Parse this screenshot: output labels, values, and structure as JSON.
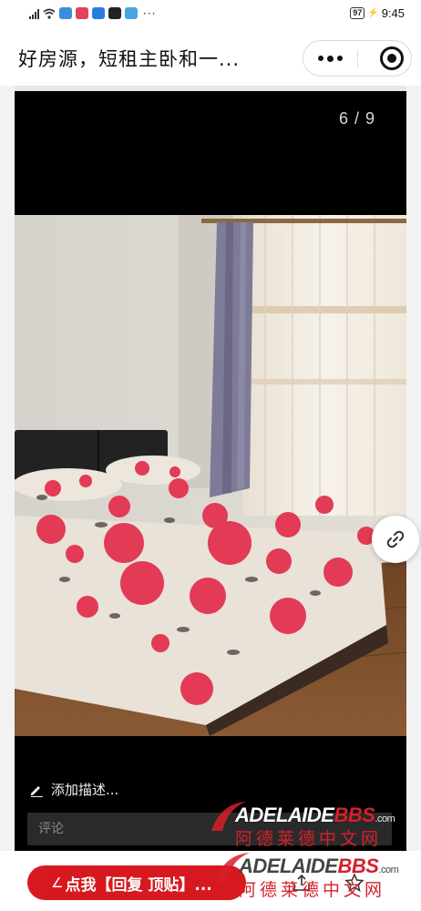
{
  "status_bar": {
    "battery": "97",
    "time": "9:45",
    "more": "···"
  },
  "header": {
    "title": "好房源，短租主卧和一..."
  },
  "viewer": {
    "counter": "6 / 9",
    "add_description": "添加描述...",
    "comment_placeholder": "评论"
  },
  "bottom_bar": {
    "reply_label": "点我【回复 顶贴】..."
  },
  "watermark": {
    "brand": "ADELAIDE",
    "brand_accent": "BBS",
    "domain": ".com",
    "site_name": "阿德莱德中文网"
  },
  "colors": {
    "accent_red": "#d7191f",
    "viewer_bg": "#000000",
    "page_bg": "#f2f2f2"
  },
  "icons": [
    "signal-icon",
    "wifi-icon",
    "more-icon",
    "close-icon",
    "pencil-icon",
    "link-icon",
    "star-icon",
    "share-icon"
  ]
}
